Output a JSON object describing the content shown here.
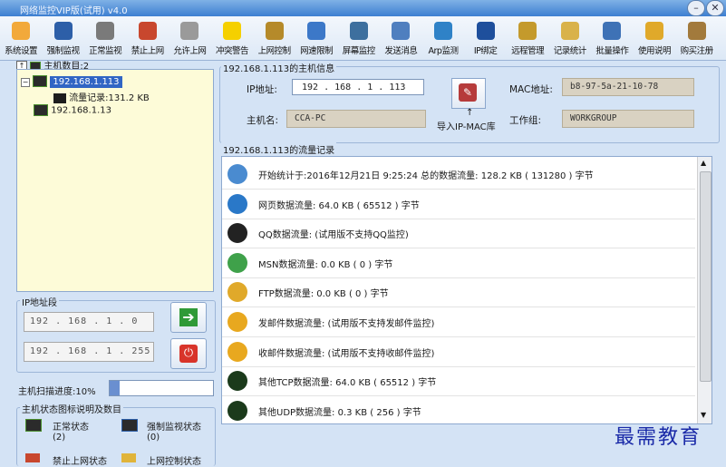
{
  "window": {
    "title": "网络监控VIP版(试用) v4.0"
  },
  "toolbar": [
    {
      "label": "系统设置",
      "color": "#f2a93b"
    },
    {
      "label": "强制监视",
      "color": "#2d5fa8"
    },
    {
      "label": "正常监视",
      "color": "#7a7a7a"
    },
    {
      "label": "禁止上网",
      "color": "#c8472e"
    },
    {
      "label": "允许上网",
      "color": "#9a9a9a"
    },
    {
      "label": "冲突警告",
      "color": "#f5d000"
    },
    {
      "label": "上网控制",
      "color": "#b58a2a"
    },
    {
      "label": "网速限制",
      "color": "#3c78c8"
    },
    {
      "label": "屏幕监控",
      "color": "#3d6f9e"
    },
    {
      "label": "发送消息",
      "color": "#4f7fbf"
    },
    {
      "label": "Arp监测",
      "color": "#2f82c7"
    },
    {
      "label": "IP绑定",
      "color": "#1e4f9c"
    },
    {
      "label": "远程管理",
      "color": "#c49a2c"
    },
    {
      "label": "记录统计",
      "color": "#d9b24a"
    },
    {
      "label": "批量操作",
      "color": "#3e72b6"
    },
    {
      "label": "使用说明",
      "color": "#e0a92a"
    },
    {
      "label": "购买注册",
      "color": "#a27a3c"
    }
  ],
  "hosts": {
    "count_label": "主机数目:2",
    "items": [
      "192.168.1.113",
      "流量记录:131.2 KB",
      "192.168.1.13"
    ]
  },
  "ip_range": {
    "title": "IP地址段",
    "start": "192 . 168 . 1 . 0",
    "end": "192 . 168 . 1 . 255"
  },
  "scan": {
    "label": "主机扫描进度:10%",
    "progress": 0.1
  },
  "legend": {
    "title": "主机状态图标说明及数目",
    "items": [
      {
        "label": "正常状态",
        "count": "(2)"
      },
      {
        "label": "强制监视状态",
        "count": "(0)"
      },
      {
        "label": "禁止上网状态",
        "count": ""
      },
      {
        "label": "上网控制状态",
        "count": ""
      }
    ]
  },
  "host_info": {
    "title": "192.168.1.113的主机信息",
    "ip_label": "IP地址:",
    "ip_value": "192 . 168 . 1 . 113",
    "mac_label": "MAC地址:",
    "mac_value": "b8-97-5a-21-10-78",
    "name_label": "主机名:",
    "name_value": "CCA-PC",
    "group_label": "工作组:",
    "group_value": "WORKGROUP",
    "import_label": "导入IP-MAC库"
  },
  "traffic": {
    "title": "192.168.1.113的流量记录",
    "rows": [
      {
        "text": "开始统计于:2016年12月21日 9:25:24 总的数据流量: 128.2 KB ( 131280 ) 字节",
        "color": "#4a8bd0"
      },
      {
        "text": "网页数据流量: 64.0 KB ( 65512 ) 字节",
        "color": "#2a78c8"
      },
      {
        "text": "QQ数据流量: (试用版不支持QQ监控)",
        "color": "#222222"
      },
      {
        "text": "MSN数据流量: 0.0 KB ( 0 ) 字节",
        "color": "#3fa14a"
      },
      {
        "text": "FTP数据流量: 0.0 KB ( 0 ) 字节",
        "color": "#e0a92a"
      },
      {
        "text": "发邮件数据流量: (试用版不支持发邮件监控)",
        "color": "#e8a81f"
      },
      {
        "text": "收邮件数据流量: (试用版不支持收邮件监控)",
        "color": "#e8a81f"
      },
      {
        "text": "其他TCP数据流量: 64.0 KB ( 65512 ) 字节",
        "color": "#1b3a1b"
      },
      {
        "text": "其他UDP数据流量: 0.3 KB ( 256 ) 字节",
        "color": "#1b3a1b"
      }
    ]
  },
  "watermark": "最需教育"
}
